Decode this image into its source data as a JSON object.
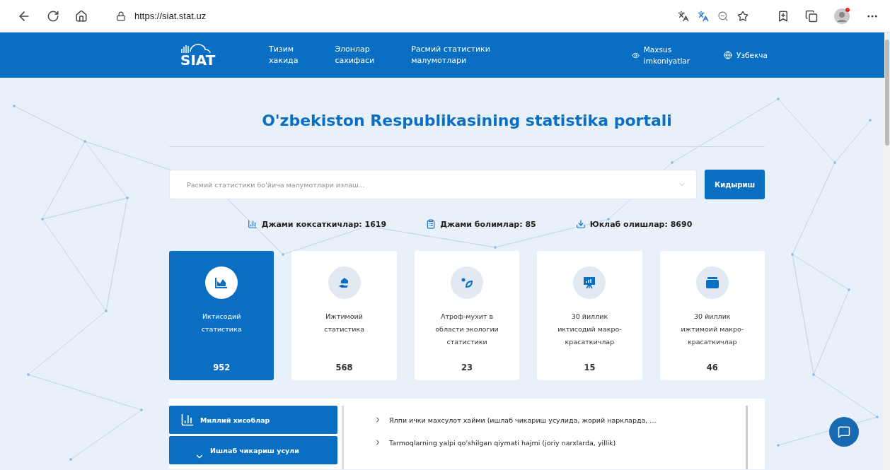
{
  "browser": {
    "url": "https://siat.stat.uz"
  },
  "header": {
    "logo": "SIAT",
    "nav": [
      {
        "label": "Тизим\nхакида"
      },
      {
        "label": "Элонлар\nсахифаси"
      },
      {
        "label": "Расмий статистики\nмалумотлари"
      }
    ],
    "accessibility": "Maxsus\nimkoniyatlar",
    "language": "Узбекча"
  },
  "title": "O'zbekiston Respublikasining statistika portali",
  "search": {
    "placeholder": "Расмий статистики бо'йича малумотлари излаш...",
    "button": "Кидыриш"
  },
  "stats": [
    {
      "kind": "chart",
      "text": "Джами коксаткичлар: 1619"
    },
    {
      "kind": "clipboard",
      "text": "Джами болимлар: 85"
    },
    {
      "kind": "download",
      "text": "Юклаб олишлар: 8690"
    }
  ],
  "cards": [
    {
      "kind": "economy",
      "label": "Иктисодий\nстатистика",
      "count": "952",
      "selected": true
    },
    {
      "kind": "social",
      "label": "Ижтимоий\nстатистика",
      "count": "568",
      "selected": false
    },
    {
      "kind": "ecology",
      "label": "Атроф-мухит в\nобласти экологии\nстатистики",
      "count": "23",
      "selected": false
    },
    {
      "kind": "presentation",
      "label": "30 йиллик\nиктисодий макро-\nкрасаткичлар",
      "count": "15",
      "selected": false
    },
    {
      "kind": "stack",
      "label": "30 йиллик\nижтимоий макро-\nкрасаткичлар",
      "count": "46",
      "selected": false
    }
  ],
  "sidebar": [
    {
      "label": "Миллий хисоблар",
      "expanded": false
    },
    {
      "label": "Ишлаб чикариш усули",
      "expanded": true
    }
  ],
  "list": [
    "Ялпи ички махсулот хайми (ишлаб чикариш усулида, жорий наркларда, ...",
    "Tarmoqlarning yalpi qo'shilgan qiymati hajmi (joriy narxlarda, yillik)"
  ]
}
